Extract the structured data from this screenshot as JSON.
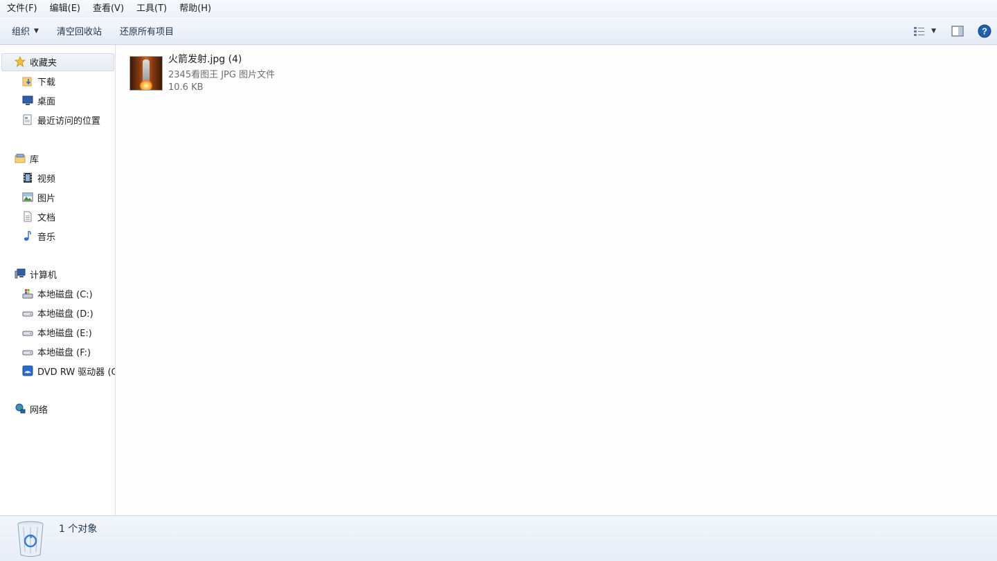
{
  "menubar": {
    "items": [
      "文件(F)",
      "编辑(E)",
      "查看(V)",
      "工具(T)",
      "帮助(H)"
    ]
  },
  "toolbar": {
    "organize_label": "组织",
    "empty_recycle_label": "清空回收站",
    "restore_all_label": "还原所有项目"
  },
  "sidebar": {
    "favorites": {
      "label": "收藏夹",
      "items": [
        "下载",
        "桌面",
        "最近访问的位置"
      ]
    },
    "libraries": {
      "label": "库",
      "items": [
        "视频",
        "图片",
        "文档",
        "音乐"
      ]
    },
    "computer": {
      "label": "计算机",
      "items": [
        "本地磁盘 (C:)",
        "本地磁盘 (D:)",
        "本地磁盘 (E:)",
        "本地磁盘 (F:)",
        "DVD RW 驱动器 (G"
      ]
    },
    "network": {
      "label": "网络"
    }
  },
  "content": {
    "file": {
      "name": "火箭发射.jpg (4)",
      "type": "2345看图王 JPG 图片文件",
      "size": "10.6 KB"
    }
  },
  "statusbar": {
    "text": "1 个对象"
  },
  "colors": {
    "accent": "#1e3050",
    "secondary_text": "#6d6d6d",
    "help_icon": "#1f5fb0"
  }
}
